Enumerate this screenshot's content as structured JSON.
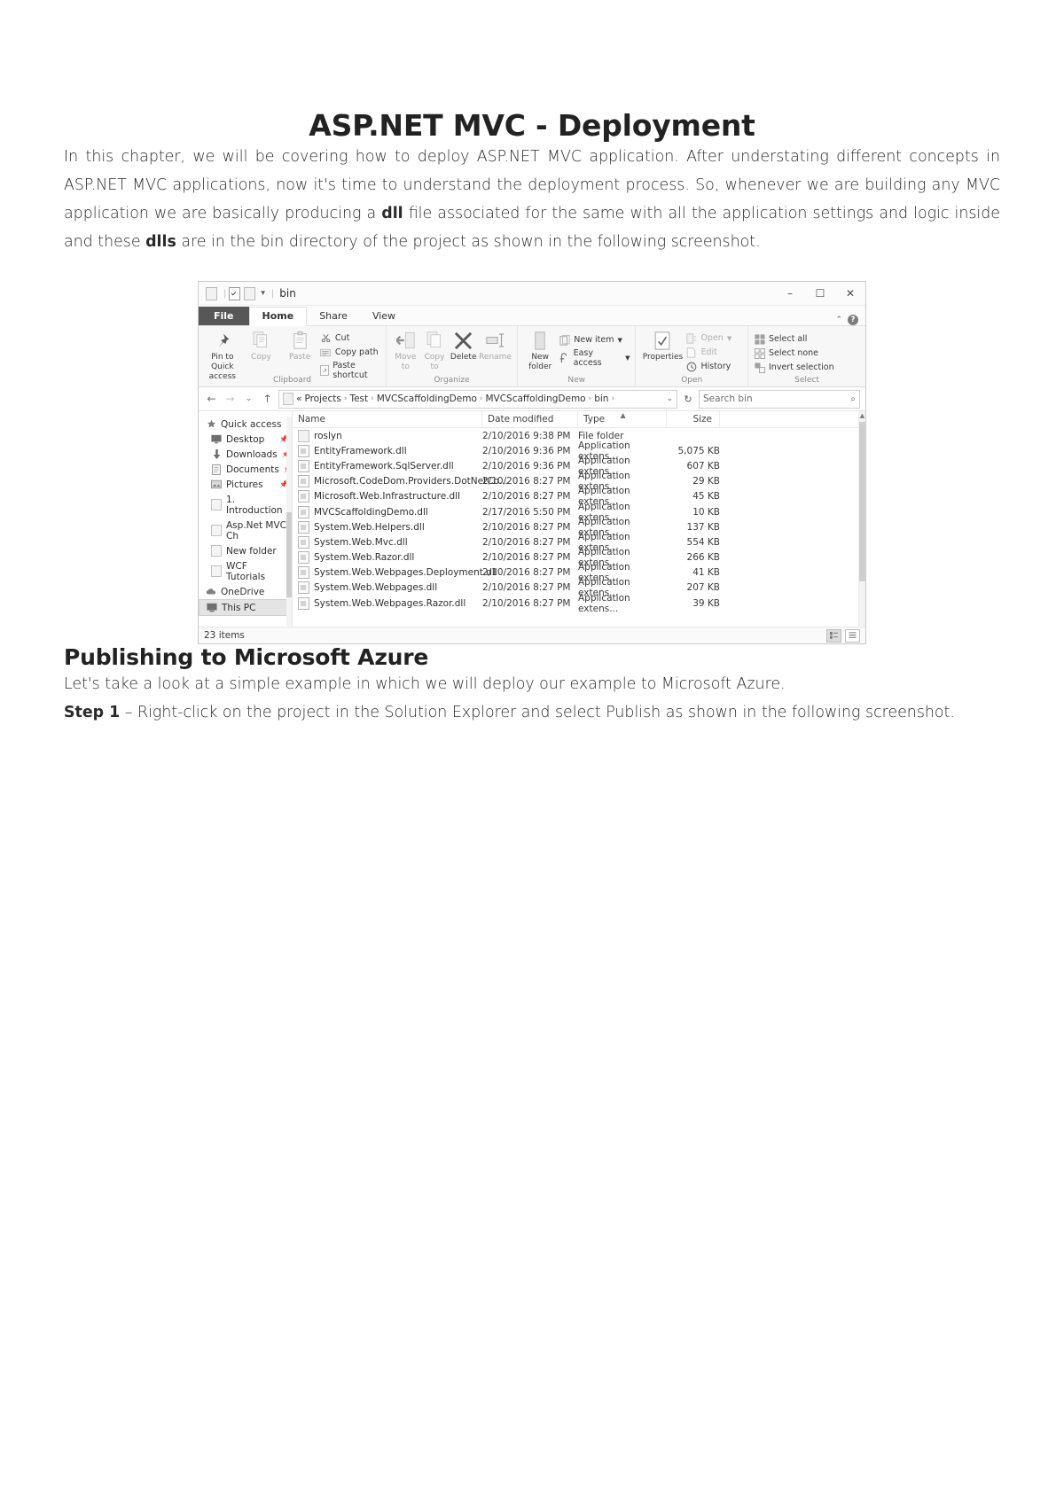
{
  "document": {
    "title": "ASP.NET MVC - Deployment",
    "intro_parts": {
      "a": "In this chapter, we will be covering how to deploy ASP.NET MVC application. After understating different concepts in ASP.NET MVC applications, now it's time to understand the deployment process. So, whenever we are building any MVC application we are basically producing a ",
      "b1": "dll",
      "c": " file associated for the same with all the application settings and logic inside and these ",
      "b2": "dlls",
      "d": " are in the bin directory of the project as shown in the following screenshot."
    },
    "section_title": "Publishing to Microsoft Azure",
    "section_intro": "Let's take a look at a simple example in which we will deploy our example to Microsoft Azure.",
    "step_label": "Step 1",
    "step_text": " – Right-click on the project in the Solution Explorer and select Publish as shown in the following screenshot."
  },
  "explorer": {
    "titlebar": {
      "title": "bin",
      "minimize": "–",
      "maximize": "☐",
      "close": "✕"
    },
    "tabs": [
      {
        "label": "File",
        "active": false,
        "style": "file"
      },
      {
        "label": "Home",
        "active": true,
        "style": "normal"
      },
      {
        "label": "Share",
        "active": false,
        "style": "normal"
      },
      {
        "label": "View",
        "active": false,
        "style": "normal"
      }
    ],
    "ribbon_collapse": "⌃",
    "ribbon_help": "?",
    "ribbon": {
      "clipboard": {
        "group": "Clipboard",
        "pin": "Pin to Quick access",
        "copy": "Copy",
        "paste": "Paste",
        "cut": "Cut",
        "copy_path": "Copy path",
        "paste_shortcut": "Paste shortcut"
      },
      "organize": {
        "group": "Organize",
        "move_to": "Move to",
        "copy_to": "Copy to",
        "delete": "Delete",
        "rename": "Rename"
      },
      "new": {
        "group": "New",
        "new_folder": "New folder",
        "new_item": "New item",
        "easy_access": "Easy access"
      },
      "open": {
        "group": "Open",
        "properties": "Properties",
        "open": "Open",
        "edit": "Edit",
        "history": "History"
      },
      "select": {
        "group": "Select",
        "select_all": "Select all",
        "select_none": "Select none",
        "invert_selection": "Invert selection"
      }
    },
    "address": {
      "back": "←",
      "forward": "→",
      "recent": "⌄",
      "up": "↑",
      "chevron_prefix": "«",
      "crumbs": [
        "Projects",
        "Test",
        "MVCScaffoldingDemo",
        "MVCScaffoldingDemo",
        "bin"
      ],
      "separator": "›",
      "dropdown": "⌄",
      "refresh": "↻",
      "search_placeholder": "Search bin"
    },
    "nav_pane": [
      {
        "label": "Quick access",
        "icon": "star-icon",
        "pin": false,
        "indent": false,
        "selected": false
      },
      {
        "label": "Desktop",
        "icon": "desktop-icon",
        "pin": true,
        "indent": true,
        "selected": false
      },
      {
        "label": "Downloads",
        "icon": "download-icon",
        "pin": true,
        "indent": true,
        "selected": false
      },
      {
        "label": "Documents",
        "icon": "documents-icon",
        "pin": true,
        "indent": true,
        "selected": false
      },
      {
        "label": "Pictures",
        "icon": "pictures-icon",
        "pin": true,
        "indent": true,
        "selected": false
      },
      {
        "label": "1. Introduction",
        "icon": "folder-icon",
        "pin": false,
        "indent": true,
        "selected": false
      },
      {
        "label": "Asp.Net MVC Ch",
        "icon": "folder-icon",
        "pin": false,
        "indent": true,
        "selected": false
      },
      {
        "label": "New folder",
        "icon": "folder-icon",
        "pin": false,
        "indent": true,
        "selected": false
      },
      {
        "label": "WCF Tutorials",
        "icon": "folder-icon",
        "pin": false,
        "indent": true,
        "selected": false
      },
      {
        "label": "OneDrive",
        "icon": "cloud-icon",
        "pin": false,
        "indent": false,
        "selected": false
      },
      {
        "label": "This PC",
        "icon": "pc-icon",
        "pin": false,
        "indent": false,
        "selected": true
      }
    ],
    "columns": [
      "Name",
      "Date modified",
      "Type",
      "Size"
    ],
    "files": [
      {
        "name": "roslyn",
        "date": "2/10/2016 9:38 PM",
        "type": "File folder",
        "size": "",
        "icon": "folder-icon"
      },
      {
        "name": "EntityFramework.dll",
        "date": "2/10/2016 9:36 PM",
        "type": "Application extens...",
        "size": "5,075 KB",
        "icon": "dll-icon"
      },
      {
        "name": "EntityFramework.SqlServer.dll",
        "date": "2/10/2016 9:36 PM",
        "type": "Application extens...",
        "size": "607 KB",
        "icon": "dll-icon"
      },
      {
        "name": "Microsoft.CodeDom.Providers.DotNetCo...",
        "date": "2/10/2016 8:27 PM",
        "type": "Application extens...",
        "size": "29 KB",
        "icon": "dll-icon"
      },
      {
        "name": "Microsoft.Web.Infrastructure.dll",
        "date": "2/10/2016 8:27 PM",
        "type": "Application extens...",
        "size": "45 KB",
        "icon": "dll-icon"
      },
      {
        "name": "MVCScaffoldingDemo.dll",
        "date": "2/17/2016 5:50 PM",
        "type": "Application extens...",
        "size": "10 KB",
        "icon": "dll-icon"
      },
      {
        "name": "System.Web.Helpers.dll",
        "date": "2/10/2016 8:27 PM",
        "type": "Application extens...",
        "size": "137 KB",
        "icon": "dll-icon"
      },
      {
        "name": "System.Web.Mvc.dll",
        "date": "2/10/2016 8:27 PM",
        "type": "Application extens...",
        "size": "554 KB",
        "icon": "dll-icon"
      },
      {
        "name": "System.Web.Razor.dll",
        "date": "2/10/2016 8:27 PM",
        "type": "Application extens...",
        "size": "266 KB",
        "icon": "dll-icon"
      },
      {
        "name": "System.Web.Webpages.Deployment.dll",
        "date": "2/10/2016 8:27 PM",
        "type": "Application extens...",
        "size": "41 KB",
        "icon": "dll-icon"
      },
      {
        "name": "System.Web.Webpages.dll",
        "date": "2/10/2016 8:27 PM",
        "type": "Application extens...",
        "size": "207 KB",
        "icon": "dll-icon"
      },
      {
        "name": "System.Web.Webpages.Razor.dll",
        "date": "2/10/2016 8:27 PM",
        "type": "Application extens...",
        "size": "39 KB",
        "icon": "dll-icon"
      }
    ],
    "status": {
      "items": "23 items"
    }
  }
}
